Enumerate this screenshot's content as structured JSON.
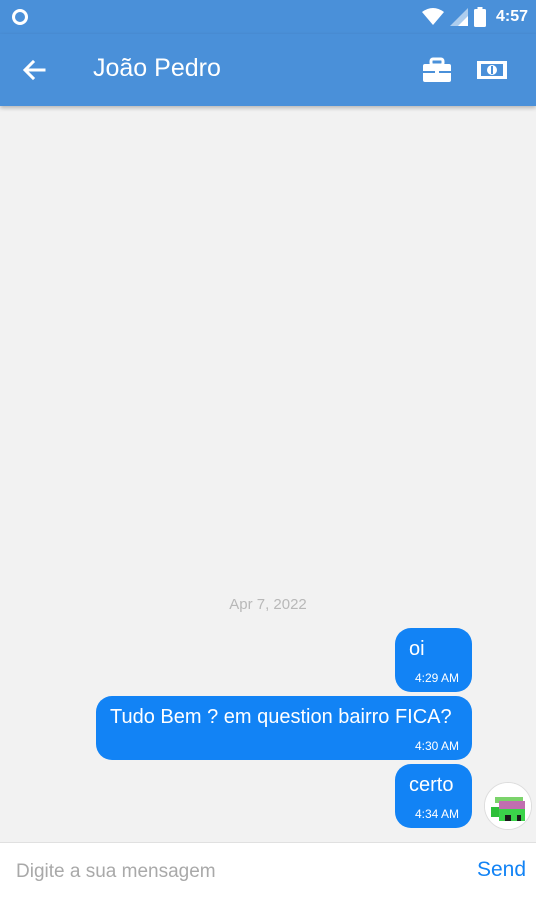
{
  "status_bar": {
    "time": "4:57"
  },
  "header": {
    "title": "João Pedro"
  },
  "chat": {
    "date_separator": "Apr 7, 2022",
    "messages": [
      {
        "text": "oi",
        "time": "4:29 AM"
      },
      {
        "text": "Tudo Bem ? em question bairro FICA?",
        "time": "4:30 AM"
      },
      {
        "text": "certo",
        "time": "4:34 AM"
      }
    ]
  },
  "input": {
    "placeholder": "Digite a sua mensagem",
    "value": ""
  },
  "send_label": "Send",
  "colors": {
    "primary": "#4a90d9",
    "bubble": "#1283f5",
    "background": "#f2f2f2",
    "send": "#1283f5"
  },
  "icons": {
    "status_left": "circle-notification-icon",
    "wifi": "wifi-icon",
    "signal": "cell-signal-icon",
    "battery": "battery-icon",
    "back": "arrow-back-icon",
    "action1": "briefcase-icon",
    "action2": "money-icon"
  }
}
